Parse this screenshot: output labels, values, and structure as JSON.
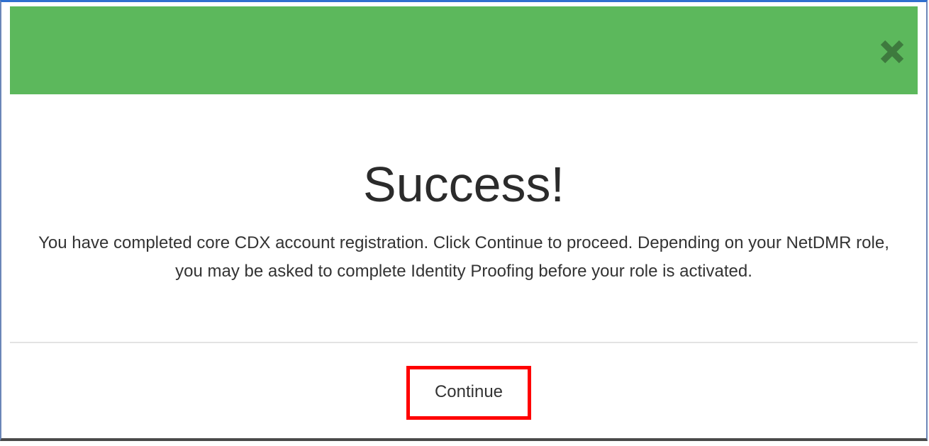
{
  "dialog": {
    "header_color": "#5cb85c",
    "close_icon": "close-icon",
    "title": "Success!",
    "message": "You have completed core CDX account registration. Click Continue to proceed. Depending on your NetDMR role, you may be asked to complete Identity Proofing before your role is activated.",
    "continue_label": "Continue",
    "highlight_color": "#ff0000"
  }
}
